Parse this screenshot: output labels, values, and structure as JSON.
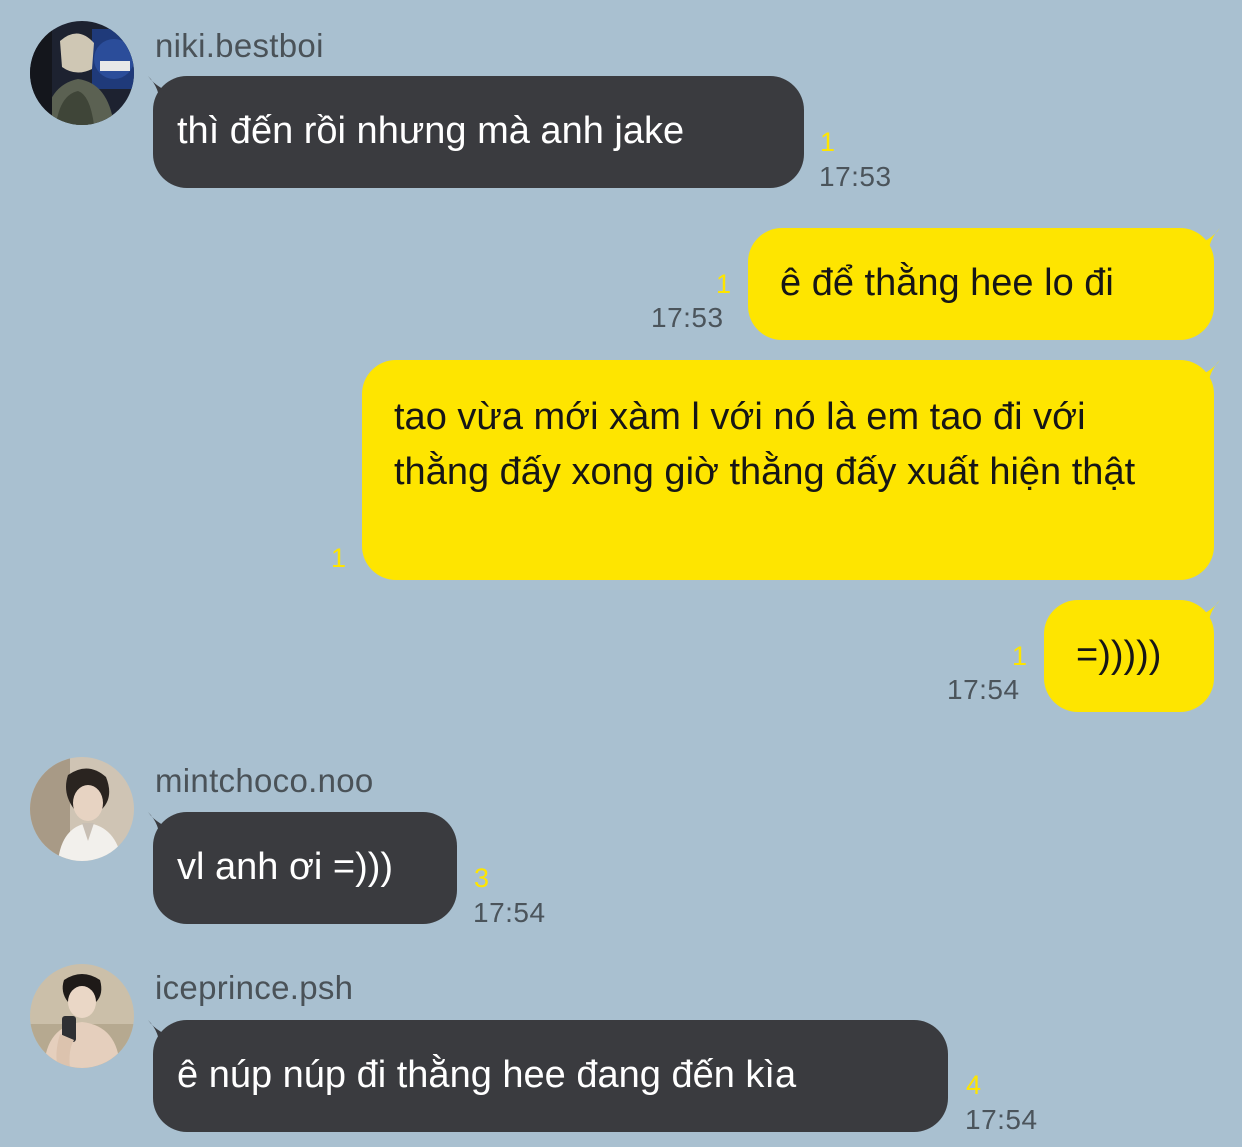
{
  "theme": {
    "background": "#a9c0d0",
    "incoming_bubble": "#3a3b3f",
    "outgoing_bubble": "#fee500",
    "unread_color": "#fee500"
  },
  "messages": [
    {
      "direction": "incoming",
      "sender": "niki.bestboi",
      "avatar": "avatar-photo",
      "text": "thì đến rồi nhưng mà anh jake",
      "unread": "1",
      "time": "17:53"
    },
    {
      "direction": "outgoing",
      "text": "ê để thằng hee lo đi",
      "unread": "1",
      "time": "17:53"
    },
    {
      "direction": "outgoing",
      "text": "tao vừa mới xàm l với nó là em tao đi với thằng đấy xong giờ thằng đấy xuất hiện thật",
      "unread": "1",
      "time": ""
    },
    {
      "direction": "outgoing",
      "text": "=)))))",
      "unread": "1",
      "time": "17:54"
    },
    {
      "direction": "incoming",
      "sender": "mintchoco.noo",
      "avatar": "avatar-photo",
      "text": "vl anh ơi =)))",
      "unread": "3",
      "time": "17:54"
    },
    {
      "direction": "incoming",
      "sender": "iceprince.psh",
      "avatar": "avatar-photo",
      "text": "ê núp núp đi thằng hee đang đến kìa",
      "unread": "4",
      "time": "17:54"
    }
  ]
}
